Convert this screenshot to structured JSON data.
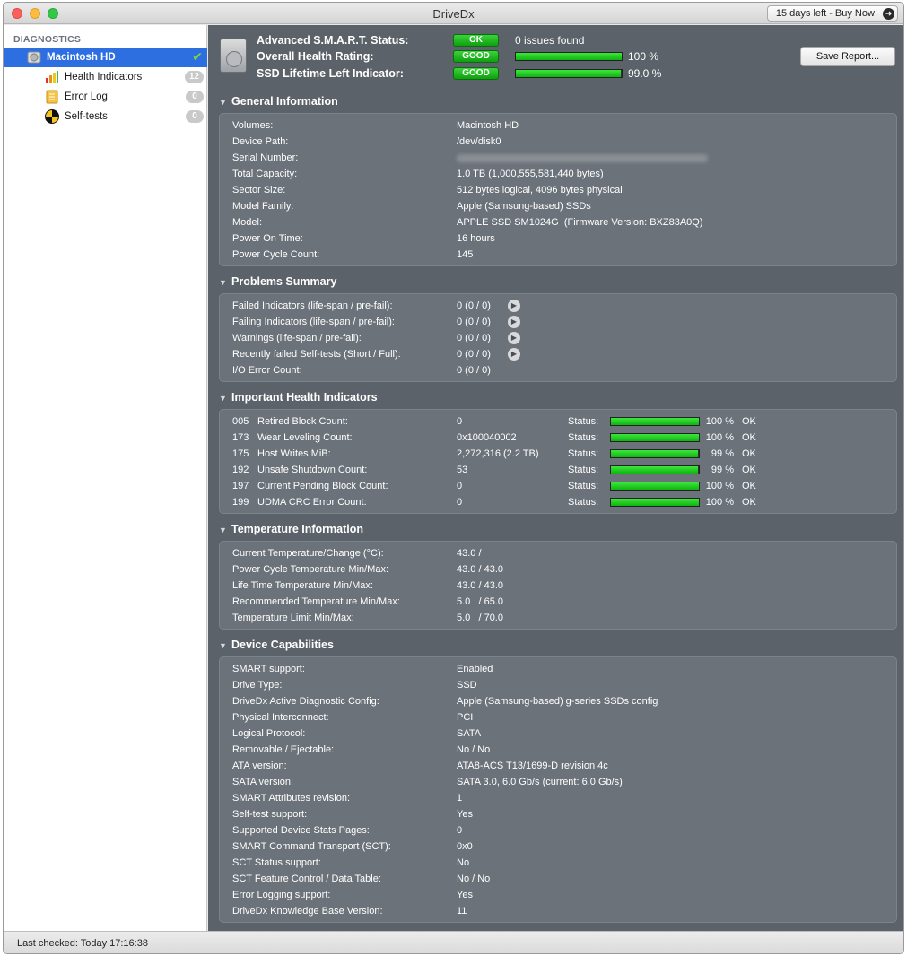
{
  "window": {
    "title": "DriveDx",
    "buy_label": "15 days left - Buy Now!"
  },
  "sidebar": {
    "section": "DIAGNOSTICS",
    "drive": {
      "label": "Macintosh HD"
    },
    "items": [
      {
        "label": "Health Indicators",
        "badge": "12"
      },
      {
        "label": "Error Log",
        "badge": "0"
      },
      {
        "label": "Self-tests",
        "badge": "0"
      }
    ]
  },
  "header": {
    "rows": [
      {
        "label": "Advanced S.M.A.R.T. Status:",
        "status": "OK",
        "value": "0 issues found"
      },
      {
        "label": "Overall Health Rating:",
        "status": "GOOD",
        "value": "100 %",
        "level": 100
      },
      {
        "label": "SSD Lifetime Left Indicator:",
        "status": "GOOD",
        "value": "99.0 %",
        "level": 99
      }
    ],
    "save_label": "Save Report..."
  },
  "general": {
    "title": "General Information",
    "rows": [
      {
        "k": "Volumes:",
        "v": "Macintosh HD"
      },
      {
        "k": "Device Path:",
        "v": "/dev/disk0"
      },
      {
        "k": "Serial Number:",
        "v": ""
      },
      {
        "k": "Total Capacity:",
        "v": "1.0 TB (1,000,555,581,440 bytes)"
      },
      {
        "k": "Sector Size:",
        "v": "512 bytes logical, 4096 bytes physical"
      },
      {
        "k": "Model Family:",
        "v": "Apple (Samsung-based) SSDs"
      },
      {
        "k": "Model:",
        "v": "APPLE SSD SM1024G  (Firmware Version: BXZ83A0Q)"
      },
      {
        "k": "Power On Time:",
        "v": "16 hours"
      },
      {
        "k": "Power Cycle Count:",
        "v": "145"
      }
    ]
  },
  "problems": {
    "title": "Problems Summary",
    "rows": [
      {
        "k": "Failed Indicators (life-span / pre-fail):",
        "v": "0 (0 / 0)"
      },
      {
        "k": "Failing Indicators (life-span / pre-fail):",
        "v": "0 (0 / 0)"
      },
      {
        "k": "Warnings (life-span / pre-fail):",
        "v": "0 (0 / 0)"
      },
      {
        "k": "Recently failed Self-tests (Short / Full):",
        "v": "0 (0 / 0)"
      },
      {
        "k": "I/O Error Count:",
        "v": "0 (0 / 0)"
      }
    ]
  },
  "health": {
    "title": "Important Health Indicators",
    "status_label": "Status:",
    "rows": [
      {
        "id": "005",
        "name": "Retired Block Count:",
        "value": "0",
        "pct": "100 %",
        "level": 100,
        "state": "OK"
      },
      {
        "id": "173",
        "name": "Wear Leveling Count:",
        "value": "0x100040002",
        "pct": "100 %",
        "level": 100,
        "state": "OK"
      },
      {
        "id": "175",
        "name": "Host Writes MiB:",
        "value": "2,272,316 (2.2 TB)",
        "pct": "99 %",
        "level": 99,
        "state": "OK"
      },
      {
        "id": "192",
        "name": "Unsafe Shutdown Count:",
        "value": "53",
        "pct": "99 %",
        "level": 99,
        "state": "OK"
      },
      {
        "id": "197",
        "name": "Current Pending Block Count:",
        "value": "0",
        "pct": "100 %",
        "level": 100,
        "state": "OK"
      },
      {
        "id": "199",
        "name": "UDMA CRC Error Count:",
        "value": "0",
        "pct": "100 %",
        "level": 100,
        "state": "OK"
      }
    ]
  },
  "temperature": {
    "title": "Temperature Information",
    "rows": [
      {
        "k": "Current Temperature/Change (°C):",
        "v": "43.0 /"
      },
      {
        "k": "Power Cycle Temperature Min/Max:",
        "v": "43.0 / 43.0"
      },
      {
        "k": "Life Time Temperature Min/Max:",
        "v": "43.0 / 43.0"
      },
      {
        "k": "Recommended Temperature Min/Max:",
        "v": "5.0   / 65.0"
      },
      {
        "k": "Temperature Limit Min/Max:",
        "v": "5.0   / 70.0"
      }
    ]
  },
  "capabilities": {
    "title": "Device Capabilities",
    "rows": [
      {
        "k": "SMART support:",
        "v": "Enabled"
      },
      {
        "k": "Drive Type:",
        "v": "SSD"
      },
      {
        "k": "DriveDx Active Diagnostic Config:",
        "v": "Apple (Samsung-based) g-series SSDs config"
      },
      {
        "k": "Physical Interconnect:",
        "v": "PCI"
      },
      {
        "k": "Logical Protocol:",
        "v": "SATA"
      },
      {
        "k": "Removable / Ejectable:",
        "v": "No / No"
      },
      {
        "k": "ATA version:",
        "v": "ATA8-ACS T13/1699-D revision 4c"
      },
      {
        "k": "SATA version:",
        "v": "SATA 3.0, 6.0 Gb/s (current: 6.0 Gb/s)"
      },
      {
        "k": "SMART Attributes revision:",
        "v": "1"
      },
      {
        "k": "Self-test support:",
        "v": "Yes"
      },
      {
        "k": "Supported Device Stats Pages:",
        "v": "0"
      },
      {
        "k": "SMART Command Transport (SCT):",
        "v": "0x0"
      },
      {
        "k": "SCT Status support:",
        "v": "No"
      },
      {
        "k": "SCT Feature Control / Data Table:",
        "v": "No / No"
      },
      {
        "k": "Error Logging support:",
        "v": "Yes"
      },
      {
        "k": "DriveDx Knowledge Base Version:",
        "v": "11"
      }
    ]
  },
  "statusbar": {
    "text": "Last checked: Today 17:16:38"
  },
  "colors": {
    "accent": "#2d6fe0",
    "panel": "#6c7279",
    "background": "#5c6269",
    "good": "#10b410"
  },
  "icons": [
    "drive-icon",
    "checkmark-icon",
    "bar-chart-icon",
    "document-icon",
    "radiation-icon",
    "info-arrow-icon",
    "disclosure-triangle-icon",
    "arrow-circle-icon"
  ]
}
